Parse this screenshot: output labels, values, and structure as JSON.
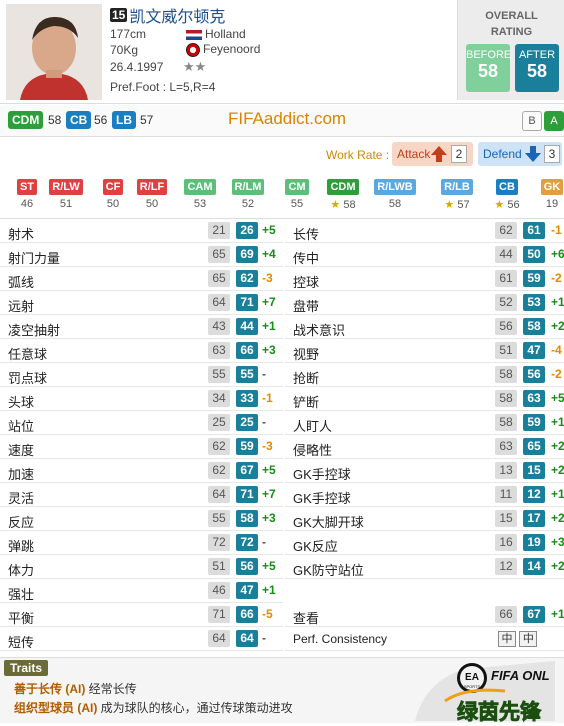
{
  "player": {
    "edition": "15",
    "name": "凯文威尔顿克",
    "height": "177cm",
    "weight": "70Kg",
    "birth": "26.4.1997",
    "stars": "★★",
    "pref_foot": "Pref.Foot : L=5,R=4",
    "nation": "Holland",
    "club": "Feyenoord"
  },
  "overall": {
    "title_line1": "OVERALL",
    "title_line2": "RATING",
    "before_label": "BEFORE",
    "before": "58",
    "after_label": "AFTER",
    "after": "58"
  },
  "positions": [
    {
      "label": "CDM",
      "value": "58",
      "color": "#2e9e3a"
    },
    {
      "label": "CB",
      "value": "56",
      "color": "#1a7fc0"
    },
    {
      "label": "LB",
      "value": "57",
      "color": "#1a7fc0"
    }
  ],
  "site": "FIFAaddict.com",
  "tags": [
    "B",
    "A"
  ],
  "workrate": {
    "label": "Work Rate :",
    "attack_label": "Attack",
    "attack": "2",
    "defend_label": "Defend",
    "defend": "3"
  },
  "all_positions": [
    {
      "label": "ST",
      "value": "46",
      "color": "#e04040",
      "star": false
    },
    {
      "label": "R/LW",
      "value": "51",
      "color": "#e04040",
      "star": false
    },
    {
      "label": "CF",
      "value": "50",
      "color": "#e04040",
      "star": false
    },
    {
      "label": "R/LF",
      "value": "50",
      "color": "#e04040",
      "star": false
    },
    {
      "label": "CAM",
      "value": "53",
      "color": "#5bbf7a",
      "star": false
    },
    {
      "label": "R/LM",
      "value": "52",
      "color": "#5bbf7a",
      "star": false
    },
    {
      "label": "CM",
      "value": "55",
      "color": "#5bbf7a",
      "star": false
    },
    {
      "label": "CDM",
      "value": "58",
      "color": "#2e9e3a",
      "star": true
    },
    {
      "label": "R/LWB",
      "value": "58",
      "color": "#5aa8e0",
      "star": false
    },
    {
      "label": "R/LB",
      "value": "57",
      "color": "#5aa8e0",
      "star": true
    },
    {
      "label": "CB",
      "value": "56",
      "color": "#1a7fc0",
      "star": true
    },
    {
      "label": "GK",
      "value": "19",
      "color": "#e0a040",
      "star": false
    }
  ],
  "left_attrs": [
    {
      "name": "射术",
      "base": "21",
      "cur": "26",
      "diff": "+5"
    },
    {
      "name": "射门力量",
      "base": "65",
      "cur": "69",
      "diff": "+4"
    },
    {
      "name": "弧线",
      "base": "65",
      "cur": "62",
      "diff": "-3"
    },
    {
      "name": "远射",
      "base": "64",
      "cur": "71",
      "diff": "+7"
    },
    {
      "name": "凌空抽射",
      "base": "43",
      "cur": "44",
      "diff": "+1"
    },
    {
      "name": "任意球",
      "base": "63",
      "cur": "66",
      "diff": "+3"
    },
    {
      "name": "罚点球",
      "base": "55",
      "cur": "55",
      "diff": "-"
    },
    {
      "name": "头球",
      "base": "34",
      "cur": "33",
      "diff": "-1"
    },
    {
      "name": "站位",
      "base": "25",
      "cur": "25",
      "diff": "-"
    },
    {
      "name": "速度",
      "base": "62",
      "cur": "59",
      "diff": "-3"
    },
    {
      "name": "加速",
      "base": "62",
      "cur": "67",
      "diff": "+5"
    },
    {
      "name": "灵活",
      "base": "64",
      "cur": "71",
      "diff": "+7"
    },
    {
      "name": "反应",
      "base": "55",
      "cur": "58",
      "diff": "+3"
    },
    {
      "name": "弹跳",
      "base": "72",
      "cur": "72",
      "diff": "-"
    },
    {
      "name": "体力",
      "base": "51",
      "cur": "56",
      "diff": "+5"
    },
    {
      "name": "强壮",
      "base": "46",
      "cur": "47",
      "diff": "+1"
    },
    {
      "name": "平衡",
      "base": "71",
      "cur": "66",
      "diff": "-5"
    },
    {
      "name": "短传",
      "base": "64",
      "cur": "64",
      "diff": "-"
    }
  ],
  "right_attrs": [
    {
      "name": "长传",
      "base": "62",
      "cur": "61",
      "diff": "-1"
    },
    {
      "name": "传中",
      "base": "44",
      "cur": "50",
      "diff": "+6"
    },
    {
      "name": "控球",
      "base": "61",
      "cur": "59",
      "diff": "-2"
    },
    {
      "name": "盘带",
      "base": "52",
      "cur": "53",
      "diff": "+1"
    },
    {
      "name": "战术意识",
      "base": "56",
      "cur": "58",
      "diff": "+2"
    },
    {
      "name": "视野",
      "base": "51",
      "cur": "47",
      "diff": "-4"
    },
    {
      "name": "抢断",
      "base": "58",
      "cur": "56",
      "diff": "-2"
    },
    {
      "name": "铲断",
      "base": "58",
      "cur": "63",
      "diff": "+5"
    },
    {
      "name": "人盯人",
      "base": "58",
      "cur": "59",
      "diff": "+1"
    },
    {
      "name": "侵略性",
      "base": "63",
      "cur": "65",
      "diff": "+2"
    },
    {
      "name": "GK手控球",
      "base": "13",
      "cur": "15",
      "diff": "+2"
    },
    {
      "name": "GK手控球",
      "base": "11",
      "cur": "12",
      "diff": "+1"
    },
    {
      "name": "GK大脚开球",
      "base": "15",
      "cur": "17",
      "diff": "+2"
    },
    {
      "name": "GK反应",
      "base": "16",
      "cur": "19",
      "diff": "+3"
    },
    {
      "name": "GK防守站位",
      "base": "12",
      "cur": "14",
      "diff": "+2"
    },
    {
      "name": "查看",
      "base": "66",
      "cur": "67",
      "diff": "+1"
    }
  ],
  "consistency": {
    "label": "Perf. Consistency",
    "a": "中",
    "b": "中"
  },
  "traits": {
    "label": "Traits",
    "items": [
      {
        "name": "善于长传 (AI)",
        "desc": "经常长传"
      },
      {
        "name": "组织型球员 (AI)",
        "desc": "成为球队的核心，通过传球策动进攻"
      }
    ]
  },
  "logo": {
    "brand": "FIFA ONLINE",
    "sub": "绿茵先锋",
    "ea": "EA SPORTS"
  }
}
